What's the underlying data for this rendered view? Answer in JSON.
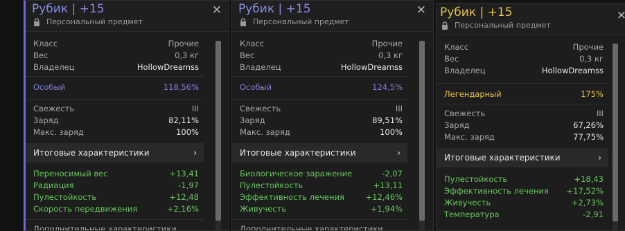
{
  "cards": [
    {
      "title": "Рубик | +15",
      "subtitle": "Персональный предмет",
      "close": "×",
      "info": [
        {
          "label": "Класс",
          "value": "Прочие"
        },
        {
          "label": "Вес",
          "value": "0,3 кг"
        },
        {
          "label": "Владелец",
          "value": "HollowDreamss"
        }
      ],
      "rarity": {
        "label": "Особый",
        "value": "118,56%",
        "color": "#8080e0"
      },
      "state": [
        {
          "label": "Свежесть",
          "value": "III"
        },
        {
          "label": "Заряд",
          "value": "82,11%"
        },
        {
          "label": "Макс. заряд",
          "value": "100%"
        }
      ],
      "summary_label": "Итоговые характеристики",
      "chevron": "›",
      "stats": [
        {
          "label": "Переносимый вес",
          "value": "+13,41"
        },
        {
          "label": "Радиация",
          "value": "-1,97"
        },
        {
          "label": "Пулестойкость",
          "value": "+12,48"
        },
        {
          "label": "Скорость передвижения",
          "value": "+2,16%"
        }
      ],
      "footer_label": "Дополнительные характеристики",
      "scroll_thumb": 0.95
    },
    {
      "title": "Рубик | +15",
      "subtitle": "Персональный предмет",
      "close": "×",
      "info": [
        {
          "label": "Класс",
          "value": "Прочие"
        },
        {
          "label": "Вес",
          "value": "0,3 кг"
        },
        {
          "label": "Владелец",
          "value": "HollowDreamss"
        }
      ],
      "rarity": {
        "label": "Особый",
        "value": "124,5%",
        "color": "#8080e0"
      },
      "state": [
        {
          "label": "Свежесть",
          "value": "III"
        },
        {
          "label": "Заряд",
          "value": "89,51%"
        },
        {
          "label": "Макс. заряд",
          "value": "100%"
        }
      ],
      "summary_label": "Итоговые характеристики",
      "chevron": "›",
      "stats": [
        {
          "label": "Биологическое заражение",
          "value": "-2,07"
        },
        {
          "label": "Пулестойкость",
          "value": "+13,11"
        },
        {
          "label": "Эффективность лечения",
          "value": "+12,46%"
        },
        {
          "label": "Живучесть",
          "value": "+1,94%"
        }
      ],
      "footer_label": "Дополнительные характеристики",
      "scroll_thumb": 0.95
    },
    {
      "title": "Рубик | +15",
      "subtitle": "Персональный предмет",
      "close": "×",
      "info": [
        {
          "label": "Класс",
          "value": "Прочие"
        },
        {
          "label": "Вес",
          "value": "0,3 кг"
        },
        {
          "label": "Владелец",
          "value": "HollowDreamss"
        }
      ],
      "rarity": {
        "label": "Легендарный",
        "value": "175%",
        "color": "#e8c24a"
      },
      "state": [
        {
          "label": "Свежесть",
          "value": "III"
        },
        {
          "label": "Заряд",
          "value": "67,26%"
        },
        {
          "label": "Макс. заряд",
          "value": "77,75%"
        }
      ],
      "summary_label": "Итоговые характеристики",
      "chevron": "›",
      "stats": [
        {
          "label": "Пулестойкость",
          "value": "+18,43"
        },
        {
          "label": "Эффективность лечения",
          "value": "+17,52%"
        },
        {
          "label": "Живучесть",
          "value": "+2,73%"
        },
        {
          "label": "Температура",
          "value": "-2,91"
        }
      ],
      "footer_label": "",
      "scroll_thumb": 0.95
    }
  ]
}
